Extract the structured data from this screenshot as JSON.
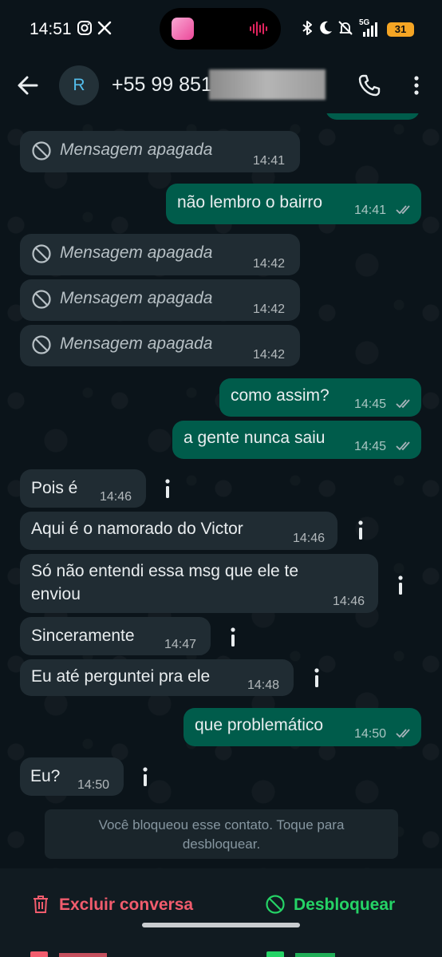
{
  "status_bar": {
    "time": "14:51",
    "network": "5G",
    "battery": "31"
  },
  "header": {
    "avatar_initial": "R",
    "contact_name": "+55 99 851"
  },
  "messages": [
    {
      "type": "in",
      "deleted": true,
      "text": "Mensagem apagada",
      "time": "14:41"
    },
    {
      "type": "out",
      "text": "não lembro o bairro",
      "time": "14:41"
    },
    {
      "type": "in",
      "deleted": true,
      "text": "Mensagem apagada",
      "time": "14:42"
    },
    {
      "type": "in",
      "deleted": true,
      "text": "Mensagem apagada",
      "time": "14:42"
    },
    {
      "type": "in",
      "deleted": true,
      "text": "Mensagem apagada",
      "time": "14:42"
    },
    {
      "type": "out",
      "text": "como assim?",
      "time": "14:45"
    },
    {
      "type": "out",
      "text": "a gente nunca saiu",
      "time": "14:45"
    },
    {
      "type": "in",
      "text": "Pois é",
      "time": "14:46"
    },
    {
      "type": "in",
      "text": "Aqui é o namorado do Victor",
      "time": "14:46"
    },
    {
      "type": "in",
      "line1": "Só não entendi essa msg que ele te",
      "line2": "enviou",
      "time": "14:46"
    },
    {
      "type": "in",
      "text": "Sinceramente",
      "time": "14:47"
    },
    {
      "type": "in",
      "text": "Eu até perguntei pra ele",
      "time": "14:48"
    },
    {
      "type": "out",
      "text": "que problemático",
      "time": "14:50"
    },
    {
      "type": "in",
      "text": "Eu?",
      "time": "14:50"
    }
  ],
  "blocked_notice": {
    "line1": "Você bloqueou esse contato. Toque para",
    "line2": "desbloquear."
  },
  "actions": {
    "delete_label": "Excluir conversa",
    "unblock_label": "Desbloquear"
  },
  "colors": {
    "incoming": "#202c33",
    "outgoing": "#005c4b",
    "delete": "#f15c6d",
    "unblock": "#25d366"
  }
}
